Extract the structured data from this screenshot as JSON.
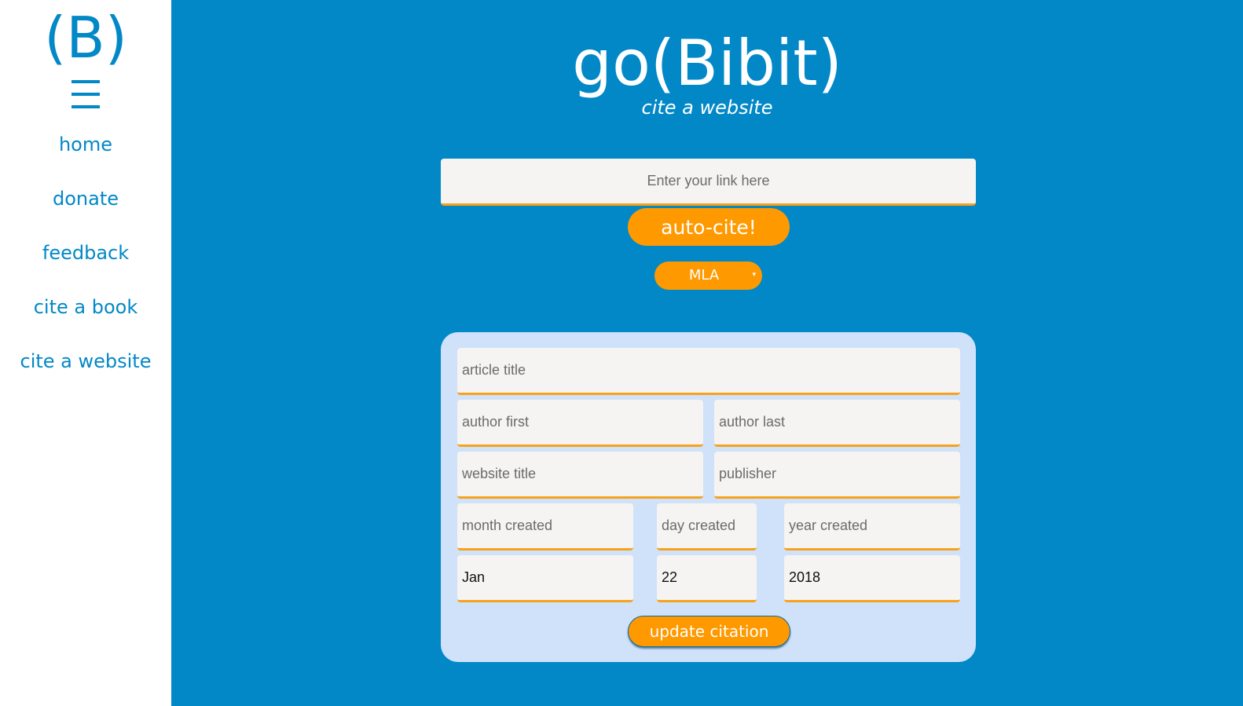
{
  "sidebar": {
    "logo": "(B)",
    "menu_icon": "hamburger-menu-icon",
    "items": [
      {
        "label": "home"
      },
      {
        "label": "donate"
      },
      {
        "label": "feedback"
      },
      {
        "label": "cite a book"
      },
      {
        "label": "cite a website"
      }
    ]
  },
  "header": {
    "title": "go(Bibit)",
    "subtitle": "cite a website"
  },
  "link": {
    "placeholder": "Enter your link here",
    "autocite_label": "auto-cite!"
  },
  "style_select": {
    "selected": "MLA",
    "caret": "▾"
  },
  "form": {
    "article_title": {
      "placeholder": "article title",
      "value": ""
    },
    "author_first": {
      "placeholder": "author first",
      "value": ""
    },
    "author_last": {
      "placeholder": "author last",
      "value": ""
    },
    "website_title": {
      "placeholder": "website title",
      "value": ""
    },
    "publisher": {
      "placeholder": "publisher",
      "value": ""
    },
    "month_created": {
      "placeholder": "month created",
      "value": ""
    },
    "day_created": {
      "placeholder": "day created",
      "value": ""
    },
    "year_created": {
      "placeholder": "year created",
      "value": ""
    },
    "month_accessed": {
      "value": "Jan"
    },
    "day_accessed": {
      "value": "22"
    },
    "year_accessed": {
      "value": "2018"
    },
    "update_label": "update citation"
  },
  "colors": {
    "primary_blue": "#0288c7",
    "accent_orange": "#ff9900",
    "panel_bg": "#cfe2fa",
    "field_bg": "#f5f4f2"
  }
}
